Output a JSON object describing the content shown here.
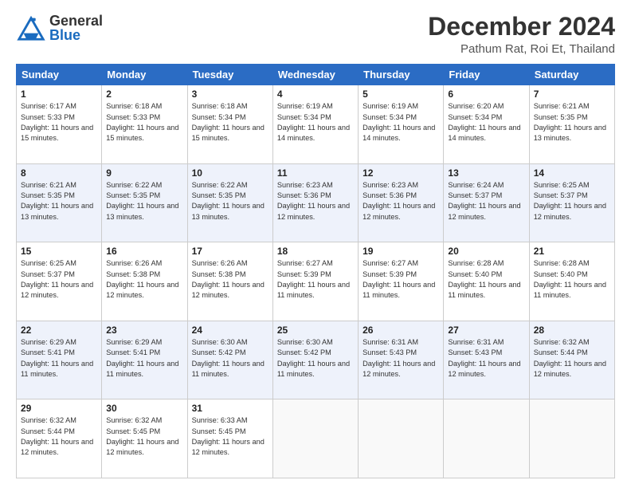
{
  "header": {
    "month": "December 2024",
    "location": "Pathum Rat, Roi Et, Thailand",
    "logo_general": "General",
    "logo_blue": "Blue"
  },
  "weekdays": [
    "Sunday",
    "Monday",
    "Tuesday",
    "Wednesday",
    "Thursday",
    "Friday",
    "Saturday"
  ],
  "weeks": [
    [
      {
        "day": "1",
        "sunrise": "Sunrise: 6:17 AM",
        "sunset": "Sunset: 5:33 PM",
        "daylight": "Daylight: 11 hours and 15 minutes."
      },
      {
        "day": "2",
        "sunrise": "Sunrise: 6:18 AM",
        "sunset": "Sunset: 5:33 PM",
        "daylight": "Daylight: 11 hours and 15 minutes."
      },
      {
        "day": "3",
        "sunrise": "Sunrise: 6:18 AM",
        "sunset": "Sunset: 5:34 PM",
        "daylight": "Daylight: 11 hours and 15 minutes."
      },
      {
        "day": "4",
        "sunrise": "Sunrise: 6:19 AM",
        "sunset": "Sunset: 5:34 PM",
        "daylight": "Daylight: 11 hours and 14 minutes."
      },
      {
        "day": "5",
        "sunrise": "Sunrise: 6:19 AM",
        "sunset": "Sunset: 5:34 PM",
        "daylight": "Daylight: 11 hours and 14 minutes."
      },
      {
        "day": "6",
        "sunrise": "Sunrise: 6:20 AM",
        "sunset": "Sunset: 5:34 PM",
        "daylight": "Daylight: 11 hours and 14 minutes."
      },
      {
        "day": "7",
        "sunrise": "Sunrise: 6:21 AM",
        "sunset": "Sunset: 5:35 PM",
        "daylight": "Daylight: 11 hours and 13 minutes."
      }
    ],
    [
      {
        "day": "8",
        "sunrise": "Sunrise: 6:21 AM",
        "sunset": "Sunset: 5:35 PM",
        "daylight": "Daylight: 11 hours and 13 minutes."
      },
      {
        "day": "9",
        "sunrise": "Sunrise: 6:22 AM",
        "sunset": "Sunset: 5:35 PM",
        "daylight": "Daylight: 11 hours and 13 minutes."
      },
      {
        "day": "10",
        "sunrise": "Sunrise: 6:22 AM",
        "sunset": "Sunset: 5:35 PM",
        "daylight": "Daylight: 11 hours and 13 minutes."
      },
      {
        "day": "11",
        "sunrise": "Sunrise: 6:23 AM",
        "sunset": "Sunset: 5:36 PM",
        "daylight": "Daylight: 11 hours and 12 minutes."
      },
      {
        "day": "12",
        "sunrise": "Sunrise: 6:23 AM",
        "sunset": "Sunset: 5:36 PM",
        "daylight": "Daylight: 11 hours and 12 minutes."
      },
      {
        "day": "13",
        "sunrise": "Sunrise: 6:24 AM",
        "sunset": "Sunset: 5:37 PM",
        "daylight": "Daylight: 11 hours and 12 minutes."
      },
      {
        "day": "14",
        "sunrise": "Sunrise: 6:25 AM",
        "sunset": "Sunset: 5:37 PM",
        "daylight": "Daylight: 11 hours and 12 minutes."
      }
    ],
    [
      {
        "day": "15",
        "sunrise": "Sunrise: 6:25 AM",
        "sunset": "Sunset: 5:37 PM",
        "daylight": "Daylight: 11 hours and 12 minutes."
      },
      {
        "day": "16",
        "sunrise": "Sunrise: 6:26 AM",
        "sunset": "Sunset: 5:38 PM",
        "daylight": "Daylight: 11 hours and 12 minutes."
      },
      {
        "day": "17",
        "sunrise": "Sunrise: 6:26 AM",
        "sunset": "Sunset: 5:38 PM",
        "daylight": "Daylight: 11 hours and 12 minutes."
      },
      {
        "day": "18",
        "sunrise": "Sunrise: 6:27 AM",
        "sunset": "Sunset: 5:39 PM",
        "daylight": "Daylight: 11 hours and 11 minutes."
      },
      {
        "day": "19",
        "sunrise": "Sunrise: 6:27 AM",
        "sunset": "Sunset: 5:39 PM",
        "daylight": "Daylight: 11 hours and 11 minutes."
      },
      {
        "day": "20",
        "sunrise": "Sunrise: 6:28 AM",
        "sunset": "Sunset: 5:40 PM",
        "daylight": "Daylight: 11 hours and 11 minutes."
      },
      {
        "day": "21",
        "sunrise": "Sunrise: 6:28 AM",
        "sunset": "Sunset: 5:40 PM",
        "daylight": "Daylight: 11 hours and 11 minutes."
      }
    ],
    [
      {
        "day": "22",
        "sunrise": "Sunrise: 6:29 AM",
        "sunset": "Sunset: 5:41 PM",
        "daylight": "Daylight: 11 hours and 11 minutes."
      },
      {
        "day": "23",
        "sunrise": "Sunrise: 6:29 AM",
        "sunset": "Sunset: 5:41 PM",
        "daylight": "Daylight: 11 hours and 11 minutes."
      },
      {
        "day": "24",
        "sunrise": "Sunrise: 6:30 AM",
        "sunset": "Sunset: 5:42 PM",
        "daylight": "Daylight: 11 hours and 11 minutes."
      },
      {
        "day": "25",
        "sunrise": "Sunrise: 6:30 AM",
        "sunset": "Sunset: 5:42 PM",
        "daylight": "Daylight: 11 hours and 11 minutes."
      },
      {
        "day": "26",
        "sunrise": "Sunrise: 6:31 AM",
        "sunset": "Sunset: 5:43 PM",
        "daylight": "Daylight: 11 hours and 12 minutes."
      },
      {
        "day": "27",
        "sunrise": "Sunrise: 6:31 AM",
        "sunset": "Sunset: 5:43 PM",
        "daylight": "Daylight: 11 hours and 12 minutes."
      },
      {
        "day": "28",
        "sunrise": "Sunrise: 6:32 AM",
        "sunset": "Sunset: 5:44 PM",
        "daylight": "Daylight: 11 hours and 12 minutes."
      }
    ],
    [
      {
        "day": "29",
        "sunrise": "Sunrise: 6:32 AM",
        "sunset": "Sunset: 5:44 PM",
        "daylight": "Daylight: 11 hours and 12 minutes."
      },
      {
        "day": "30",
        "sunrise": "Sunrise: 6:32 AM",
        "sunset": "Sunset: 5:45 PM",
        "daylight": "Daylight: 11 hours and 12 minutes."
      },
      {
        "day": "31",
        "sunrise": "Sunrise: 6:33 AM",
        "sunset": "Sunset: 5:45 PM",
        "daylight": "Daylight: 11 hours and 12 minutes."
      },
      null,
      null,
      null,
      null
    ]
  ]
}
